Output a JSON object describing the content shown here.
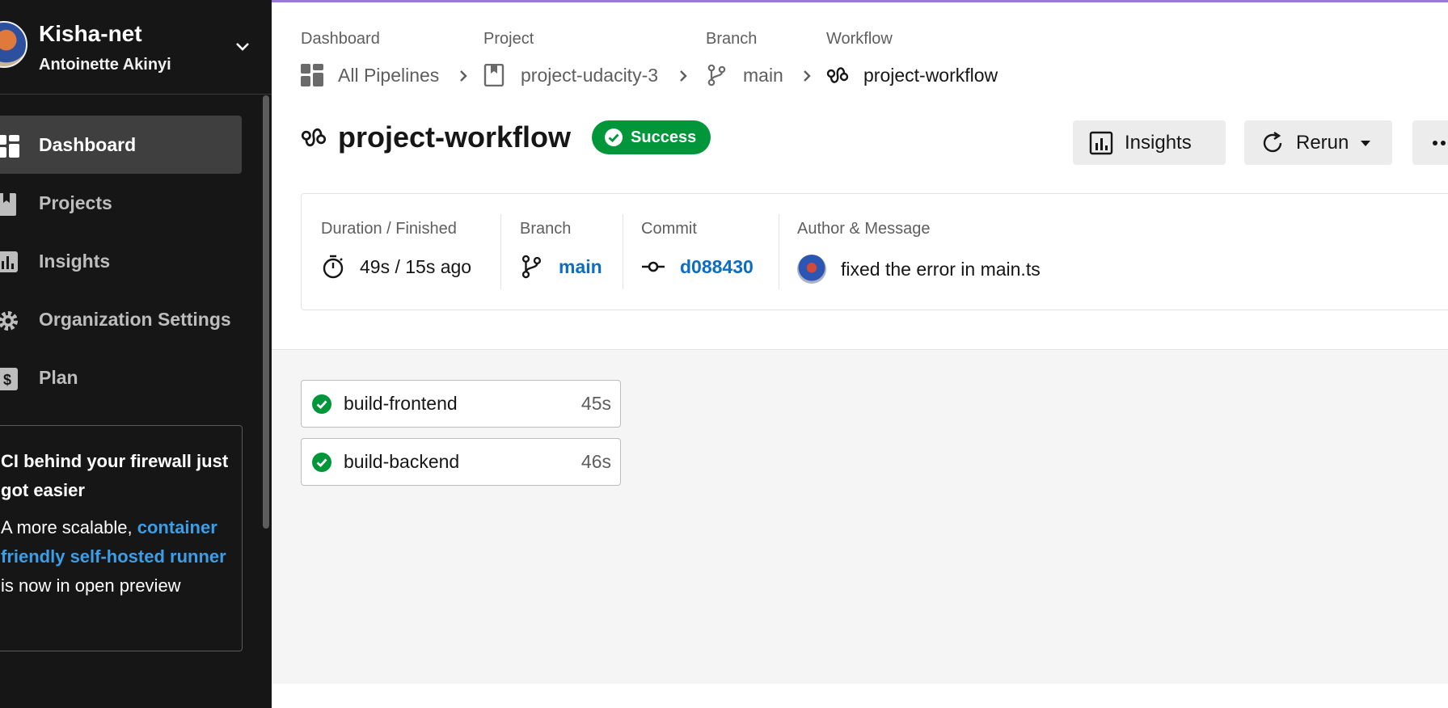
{
  "org": {
    "name": "Kisha-net",
    "user": "Antoinette Akinyi"
  },
  "sidebar": {
    "items": [
      {
        "label": "Dashboard",
        "icon": "dashboard-icon",
        "active": true
      },
      {
        "label": "Projects",
        "icon": "bookmark-icon"
      },
      {
        "label": "Insights",
        "icon": "bar-chart-icon"
      },
      {
        "label": "Organization Settings",
        "icon": "gear-icon"
      },
      {
        "label": "Plan",
        "icon": "dollar-icon"
      }
    ],
    "promo": {
      "title": "CI behind your firewall just got easier",
      "body_prefix": "A more scalable, ",
      "link": "container friendly self-hosted runner",
      "body_suffix": " is now in open preview"
    }
  },
  "breadcrumb": {
    "dashboard": {
      "caption": "Dashboard",
      "label": "All Pipelines"
    },
    "project": {
      "caption": "Project",
      "label": "project-udacity-3"
    },
    "branch": {
      "caption": "Branch",
      "label": "main"
    },
    "workflow": {
      "caption": "Workflow",
      "label": "project-workflow"
    }
  },
  "header": {
    "title": "project-workflow",
    "status": "Success",
    "insights_label": "Insights",
    "rerun_label": "Rerun"
  },
  "summary": {
    "duration_caption": "Duration / Finished",
    "duration_value": "49s / 15s ago",
    "branch_caption": "Branch",
    "branch_value": "main",
    "commit_caption": "Commit",
    "commit_value": "d088430",
    "author_caption": "Author & Message",
    "message": "fixed the error in main.ts"
  },
  "jobs": [
    {
      "name": "build-frontend",
      "duration": "45s",
      "status": "success"
    },
    {
      "name": "build-backend",
      "duration": "46s",
      "status": "success"
    }
  ],
  "colors": {
    "success": "#009639",
    "link": "#0b6dc3",
    "sidebar_bg": "#161616"
  }
}
